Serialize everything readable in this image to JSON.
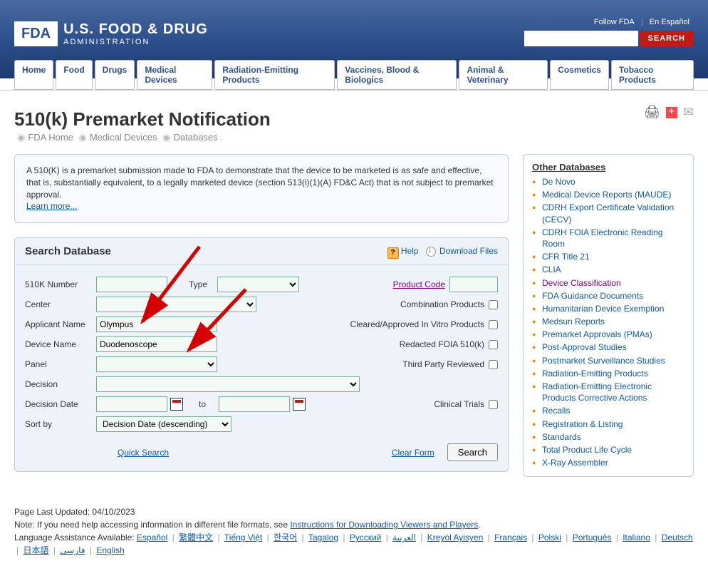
{
  "header": {
    "follow_fda": "Follow FDA",
    "espanol": "En Español",
    "search_btn": "SEARCH",
    "logo_box": "FDA",
    "agency_line1": "U.S. FOOD & DRUG",
    "agency_line2": "ADMINISTRATION"
  },
  "nav": [
    "Home",
    "Food",
    "Drugs",
    "Medical Devices",
    "Radiation-Emitting Products",
    "Vaccines, Blood & Biologics",
    "Animal & Veterinary",
    "Cosmetics",
    "Tobacco Products"
  ],
  "page_title": "510(k) Premarket Notification",
  "breadcrumb": [
    "FDA Home",
    "Medical Devices",
    "Databases"
  ],
  "info_text": "A 510(K) is a premarket submission made to FDA to demonstrate that the device to be marketed is as safe and effective, that is, substantially equivalent, to a legally marketed device (section 513(i)(1)(A) FD&C Act) that is not subject to premarket approval.",
  "learn_more": "Learn more...",
  "panel": {
    "title": "Search Database",
    "help": "Help",
    "download": "Download Files",
    "labels": {
      "knumber": "510K Number",
      "type": "Type",
      "product_code": "Product Code",
      "center": "Center",
      "combination": "Combination Products",
      "applicant": "Applicant Name",
      "cleared": "Cleared/Approved In Vitro Products",
      "device": "Device Name",
      "redacted": "Redacted FOIA 510(k)",
      "panel_lbl": "Panel",
      "thirdparty": "Third Party Reviewed",
      "decision": "Decision",
      "decision_date": "Decision Date",
      "to": "to",
      "clinical": "Clinical Trials",
      "sortby": "Sort by",
      "sort_value": "Decision Date (descending)",
      "quick": "Quick Search",
      "clear": "Clear Form",
      "search": "Search"
    },
    "values": {
      "applicant": "Olympus",
      "device": "Duodenoscope"
    }
  },
  "sidebar": {
    "title": "Other Databases",
    "links": [
      {
        "label": "De Novo",
        "visited": false
      },
      {
        "label": "Medical Device Reports (MAUDE)",
        "visited": false
      },
      {
        "label": "CDRH Export Certificate Validation (CECV)",
        "visited": false
      },
      {
        "label": "CDRH FOIA Electronic Reading Room",
        "visited": false
      },
      {
        "label": "CFR Title 21",
        "visited": false
      },
      {
        "label": "CLIA",
        "visited": false
      },
      {
        "label": "Device Classification",
        "visited": true
      },
      {
        "label": "FDA Guidance Documents",
        "visited": false
      },
      {
        "label": "Humanitarian Device Exemption",
        "visited": false
      },
      {
        "label": "Medsun Reports",
        "visited": false
      },
      {
        "label": "Premarket Approvals (PMAs)",
        "visited": false
      },
      {
        "label": "Post-Approval Studies",
        "visited": false
      },
      {
        "label": "Postmarket Surveillance Studies",
        "visited": false
      },
      {
        "label": "Radiation-Emitting Products",
        "visited": false
      },
      {
        "label": "Radiation-Emitting Electronic Products Corrective Actions",
        "visited": false
      },
      {
        "label": "Recalls",
        "visited": false
      },
      {
        "label": "Registration & Listing",
        "visited": false
      },
      {
        "label": "Standards",
        "visited": false
      },
      {
        "label": "Total Product Life Cycle",
        "visited": false
      },
      {
        "label": "X-Ray Assembler",
        "visited": false
      }
    ]
  },
  "footer": {
    "updated_label": "Page Last Updated: ",
    "updated_date": "04/10/2023",
    "note_prefix": "Note: If you need help accessing information in different file formats, see ",
    "note_link": "Instructions for Downloading Viewers and Players",
    "lang_label": "Language Assistance Available: ",
    "languages": [
      "Español",
      "繁體中文",
      "Tiếng Việt",
      "한국어",
      "Tagalog",
      "Русский",
      "العربية",
      "Kreyòl Ayisyen",
      "Français",
      "Polski",
      "Português",
      "Italiano",
      "Deutsch",
      "日本語",
      "فارسی",
      "English"
    ]
  }
}
